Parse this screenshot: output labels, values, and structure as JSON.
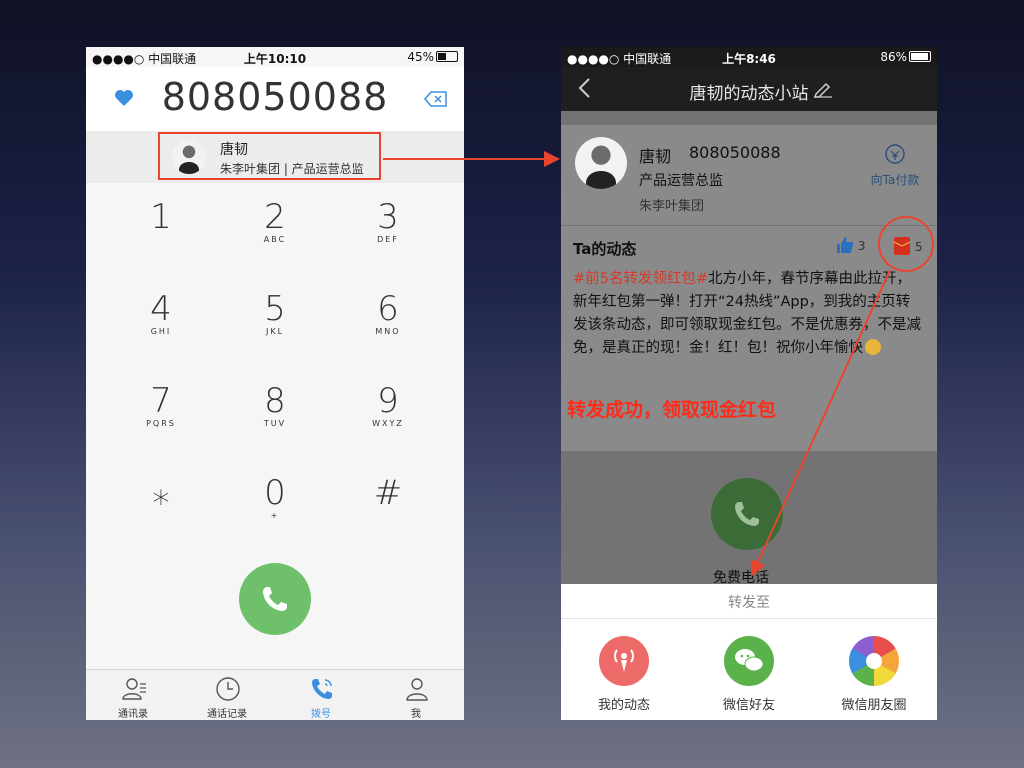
{
  "left": {
    "status": {
      "carrier": "●●●●○ 中国联通",
      "time": "上午10:10",
      "battery": "45%"
    },
    "dial_number": "808050088",
    "match": {
      "name": "唐韧",
      "org_title": "朱李叶集团 | 产品运营总监"
    },
    "keys": [
      {
        "digit": "1",
        "letters": ""
      },
      {
        "digit": "2",
        "letters": "ABC"
      },
      {
        "digit": "3",
        "letters": "DEF"
      },
      {
        "digit": "4",
        "letters": "GHI"
      },
      {
        "digit": "5",
        "letters": "JKL"
      },
      {
        "digit": "6",
        "letters": "MNO"
      },
      {
        "digit": "7",
        "letters": "PQRS"
      },
      {
        "digit": "8",
        "letters": "TUV"
      },
      {
        "digit": "9",
        "letters": "WXYZ"
      },
      {
        "digit": "⁎",
        "letters": ""
      },
      {
        "digit": "0",
        "letters": "+"
      },
      {
        "digit": "#",
        "letters": ""
      }
    ],
    "tabs": [
      {
        "label": "通讯录",
        "icon": "contacts-icon"
      },
      {
        "label": "通话记录",
        "icon": "clock-icon"
      },
      {
        "label": "拨号",
        "icon": "phone-icon",
        "active": true
      },
      {
        "label": "我",
        "icon": "person-icon"
      }
    ]
  },
  "right": {
    "status": {
      "carrier": "●●●●○ 中国联通",
      "time": "上午8:46",
      "battery": "86%"
    },
    "nav_title": "唐韧的动态小站",
    "profile": {
      "name": "唐韧",
      "phone": "808050088",
      "title": "产品运营总监",
      "org": "朱李叶集团",
      "pay_label": "向Ta付款"
    },
    "post": {
      "title": "Ta的动态",
      "likes": "3",
      "shares": "5",
      "hashtag": "#前5名转发领红包#",
      "body": "北方小年，春节序幕由此拉开，新年红包第一弹！打开“24热线”App，到我的主页转发该条动态，即可领取现金红包。不是优惠券，不是减免，是真正的现！金！红！包！祝你小年愉快"
    },
    "annotation": "转发成功，领取现金红包",
    "free_call": "免费电话",
    "share_sheet": {
      "title": "转发至",
      "options": [
        {
          "label": "我的动态",
          "icon": "broadcast-icon"
        },
        {
          "label": "微信好友",
          "icon": "wechat-icon"
        },
        {
          "label": "微信朋友圈",
          "icon": "moments-icon"
        }
      ]
    }
  },
  "colors": {
    "accent_blue": "#3b8fe0",
    "call_green": "#6ec16a",
    "annotation_red": "#e8452c"
  }
}
